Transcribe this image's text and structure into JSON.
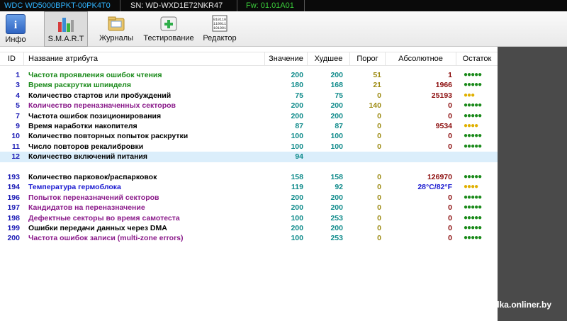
{
  "titlebar": {
    "model": "WDC WD5000BPKT-00PK4T0",
    "serial": "SN: WD-WXD1E72NKR47",
    "firmware": "Fw: 01.01A01"
  },
  "toolbar": [
    {
      "label": "Инфо",
      "icon": "info-icon"
    },
    {
      "label": "S.M.A.R.T",
      "icon": "smart-chart-icon"
    },
    {
      "label": "Журналы",
      "icon": "journals-folder-icon"
    },
    {
      "label": "Тестирование",
      "icon": "testing-first-aid-icon"
    },
    {
      "label": "Редактор",
      "icon": "binary-editor-icon"
    }
  ],
  "columns": {
    "id": "ID",
    "name": "Название атрибута",
    "value": "Значение",
    "worst": "Худшее",
    "threshold": "Порог",
    "absolute": "Абсолютное",
    "health": "Остаток"
  },
  "colors": {
    "green": "#1a8a1a",
    "black": "#000000",
    "purple": "#8a1a8a",
    "blue": "#1a1ad0",
    "dot_green": "#1a8a1a",
    "dot_yellow": "#e0b000"
  },
  "rows": [
    {
      "id": "1",
      "name": "Частота проявления ошибок чтения",
      "color": "green",
      "value": "200",
      "worst": "200",
      "threshold": "51",
      "absolute": "1",
      "dots": "●●●●●",
      "dot_color": "dot_green"
    },
    {
      "id": "3",
      "name": "Время раскрутки шпинделя",
      "color": "green",
      "value": "180",
      "worst": "168",
      "threshold": "21",
      "absolute": "1966",
      "dots": "●●●●●",
      "dot_color": "dot_green"
    },
    {
      "id": "4",
      "name": "Количество стартов или пробуждений",
      "color": "black",
      "value": "75",
      "worst": "75",
      "threshold": "0",
      "absolute": "25193",
      "dots": "●●●",
      "dot_color": "dot_yellow"
    },
    {
      "id": "5",
      "name": "Количество переназначенных секторов",
      "color": "purple",
      "value": "200",
      "worst": "200",
      "threshold": "140",
      "absolute": "0",
      "dots": "●●●●●",
      "dot_color": "dot_green"
    },
    {
      "id": "7",
      "name": "Частота ошибок позиционирования",
      "color": "black",
      "value": "200",
      "worst": "200",
      "threshold": "0",
      "absolute": "0",
      "dots": "●●●●●",
      "dot_color": "dot_green"
    },
    {
      "id": "9",
      "name": "Время наработки накопителя",
      "color": "black",
      "value": "87",
      "worst": "87",
      "threshold": "0",
      "absolute": "9534",
      "dots": "●●●●",
      "dot_color": "dot_yellow"
    },
    {
      "id": "10",
      "name": "Количество повторных попыток раскрутки",
      "color": "black",
      "value": "100",
      "worst": "100",
      "threshold": "0",
      "absolute": "0",
      "dots": "●●●●●",
      "dot_color": "dot_green"
    },
    {
      "id": "11",
      "name": "Число повторов рекалибровки",
      "color": "black",
      "value": "100",
      "worst": "100",
      "threshold": "0",
      "absolute": "0",
      "dots": "●●●●●",
      "dot_color": "dot_green"
    },
    {
      "id": "12",
      "name": "Количество включений питания",
      "color": "black",
      "value": "94",
      "worst": "",
      "threshold": "",
      "absolute": "",
      "dots": "",
      "dot_color": "dot_green",
      "selected": true
    },
    {
      "id": "",
      "name": "",
      "color": "black",
      "value": "",
      "worst": "",
      "threshold": "",
      "absolute": "",
      "dots": "",
      "dot_color": "dot_green"
    },
    {
      "id": "193",
      "name": "Количество парковок/распарковок",
      "color": "black",
      "value": "158",
      "worst": "158",
      "threshold": "0",
      "absolute": "126970",
      "dots": "●●●●●",
      "dot_color": "dot_green"
    },
    {
      "id": "194",
      "name": "Температура гермоблока",
      "color": "blue",
      "value": "119",
      "worst": "92",
      "threshold": "0",
      "absolute": "28°C/82°F",
      "abs_color": "blue",
      "dots": "●●●●",
      "dot_color": "dot_yellow"
    },
    {
      "id": "196",
      "name": "Попыток переназначений секторов",
      "color": "purple",
      "value": "200",
      "worst": "200",
      "threshold": "0",
      "absolute": "0",
      "dots": "●●●●●",
      "dot_color": "dot_green"
    },
    {
      "id": "197",
      "name": "Кандидатов на переназначение",
      "color": "purple",
      "value": "200",
      "worst": "200",
      "threshold": "0",
      "absolute": "0",
      "dots": "●●●●●",
      "dot_color": "dot_green"
    },
    {
      "id": "198",
      "name": "Дефектные секторы во время самотеста",
      "color": "purple",
      "value": "100",
      "worst": "253",
      "threshold": "0",
      "absolute": "0",
      "dots": "●●●●●",
      "dot_color": "dot_green"
    },
    {
      "id": "199",
      "name": "Ошибки передачи данных через DMA",
      "color": "black",
      "value": "200",
      "worst": "200",
      "threshold": "0",
      "absolute": "0",
      "dots": "●●●●●",
      "dot_color": "dot_green"
    },
    {
      "id": "200",
      "name": "Частота ошибок записи (multi-zone errors)",
      "color": "purple",
      "value": "100",
      "worst": "253",
      "threshold": "0",
      "absolute": "0",
      "dots": "●●●●●",
      "dot_color": "dot_green"
    }
  ],
  "watermark": "sinlis для baraholka.onliner.by"
}
